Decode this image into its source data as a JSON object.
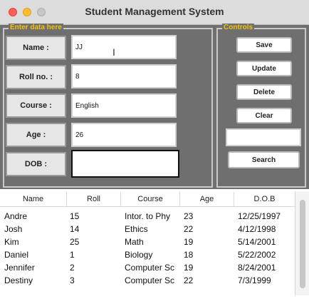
{
  "window": {
    "title": "Student Management System"
  },
  "entry_frame": {
    "label": "Enter data here",
    "fields": [
      {
        "label": "Name :",
        "value": "JJ"
      },
      {
        "label": "Roll no. :",
        "value": "8"
      },
      {
        "label": "Course :",
        "value": "English"
      },
      {
        "label": "Age :",
        "value": "26"
      },
      {
        "label": "DOB :",
        "value": ""
      }
    ]
  },
  "controls_frame": {
    "label": "Controls",
    "buttons": [
      "Save",
      "Update",
      "Delete",
      "Clear"
    ],
    "search_value": "",
    "search_button": "Search"
  },
  "table": {
    "columns": [
      "Name",
      "Roll",
      "Course",
      "Age",
      "D.O.B"
    ],
    "rows": [
      [
        "Andre",
        "15",
        "Intor. to Phy",
        "23",
        "12/25/1997"
      ],
      [
        "Josh",
        "14",
        "Ethics",
        "22",
        "4/12/1998"
      ],
      [
        "Kim",
        "25",
        "Math",
        "19",
        "5/14/2001"
      ],
      [
        "Daniel",
        "1",
        "Biology",
        "18",
        "5/22/2002"
      ],
      [
        "Jennifer",
        "2",
        "Computer Sc",
        "19",
        "8/24/2001"
      ],
      [
        "Destiny",
        "3",
        "Computer Sc",
        "22",
        "7/3/1999"
      ]
    ]
  }
}
